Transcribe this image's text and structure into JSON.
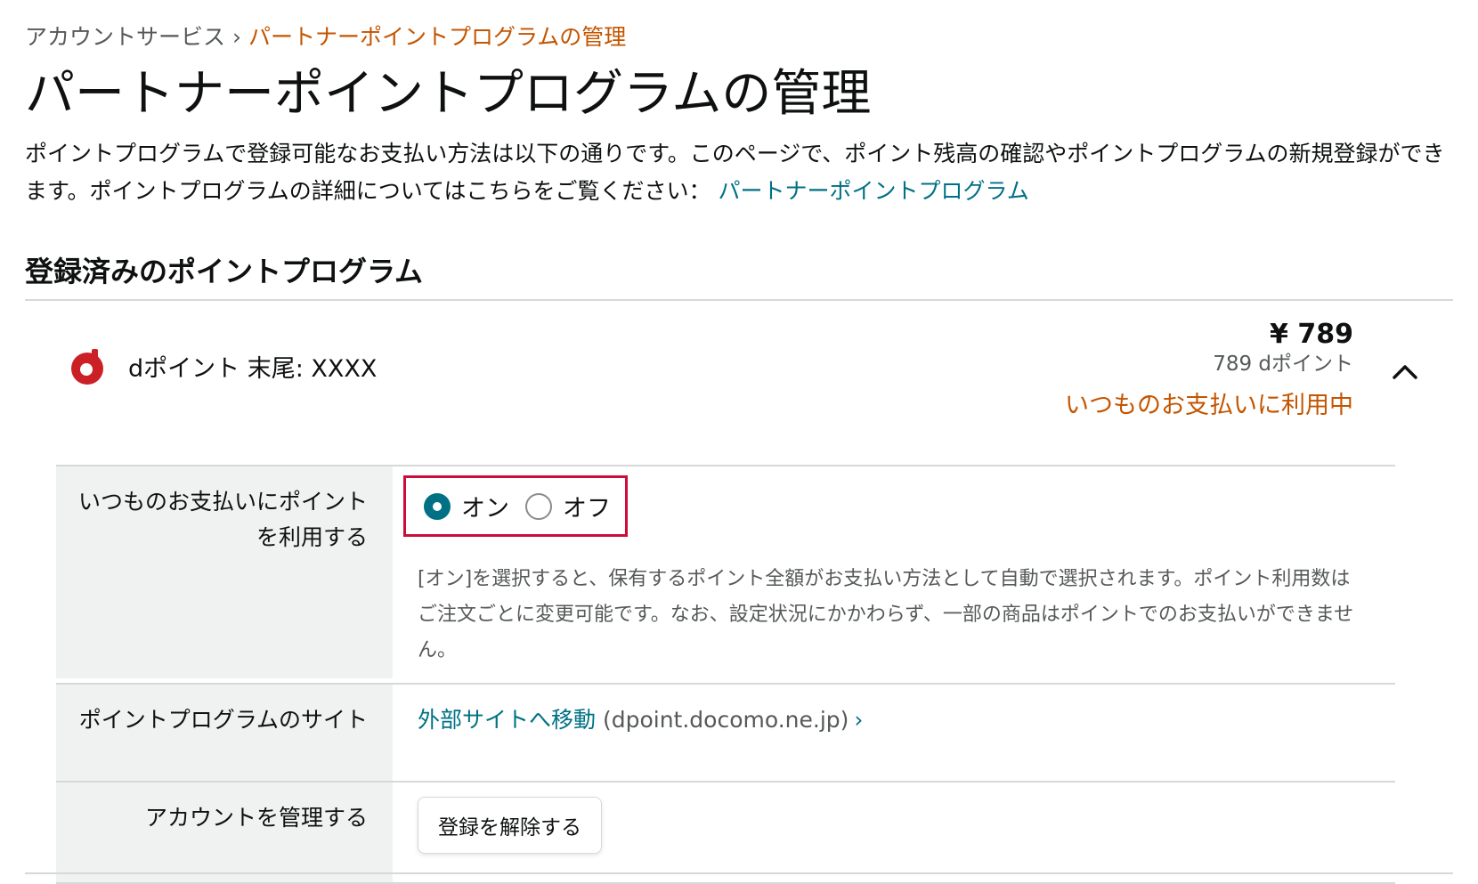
{
  "breadcrumb": {
    "parent": "アカウントサービス",
    "separator": "›",
    "current": "パートナーポイントプログラムの管理"
  },
  "title": "パートナーポイントプログラムの管理",
  "intro": {
    "text": "ポイントプログラムで登録可能なお支払い方法は以下の通りです。このページで、ポイント残高の確認やポイントプログラムの新規登録ができます。ポイントプログラムの詳細についてはこちらをご覧ください：",
    "link": "パートナーポイントプログラム"
  },
  "section_heading": "登録済みのポイントプログラム",
  "program": {
    "logo_icon": "dpoint-logo-icon",
    "name": "dポイント 末尾: XXXX",
    "balance_amount": "¥ 789",
    "balance_points": "789 dポイント",
    "status": "いつものお支払いに利用中",
    "chevron_icon": "chevron-up-icon"
  },
  "details": {
    "use_points": {
      "label": "いつものお支払いにポイントを利用する",
      "on_label": "オン",
      "off_label": "オフ",
      "selected": "on",
      "note": "[オン]を選択すると、保有するポイント全額がお支払い方法として自動で選択されます。ポイント利用数はご注文ごとに変更可能です。なお、設定状況にかかわらず、一部の商品はポイントでのお支払いができません。"
    },
    "site": {
      "label": "ポイントプログラムのサイト",
      "link_text": "外部サイトへ移動",
      "domain": "(dpoint.docomo.ne.jp)",
      "arrow": "›"
    },
    "account": {
      "label": "アカウントを管理する",
      "button": "登録を解除する"
    }
  },
  "colors": {
    "accent_orange": "#c45500",
    "link_teal": "#007185",
    "highlight_red": "#cc0c39",
    "dpoint_red": "#cc2027"
  }
}
